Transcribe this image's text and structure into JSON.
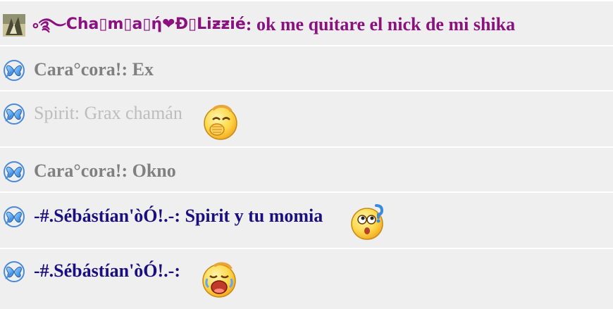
{
  "messages": [
    {
      "sender": "Cha▯m▯a▯ή❤Đ▯Liƶƶié",
      "sender_prefix": "༚࿐",
      "separator": ":",
      "text": " ok me quitare el nick de mi shika",
      "color": "#8b1180",
      "avatar": "photo-avatar-icon",
      "emoticon": null
    },
    {
      "sender": "Cara°cora!",
      "separator": ":",
      "text": " Ex",
      "color": "#808080",
      "avatar": "messenger-butterfly-icon",
      "emoticon": null
    },
    {
      "sender": "Spirit",
      "separator": ":",
      "text": " Grax chamán",
      "color": "#bdbdbd",
      "avatar": "messenger-butterfly-icon",
      "emoticon": "giggle-emoticon"
    },
    {
      "sender": "Cara°cora!",
      "separator": ":",
      "text": " Okno",
      "color": "#808080",
      "avatar": "messenger-butterfly-icon",
      "emoticon": null
    },
    {
      "sender": "-#.Sébástían'òÓ!.-",
      "separator": ":",
      "text": " Spirit y tu momia",
      "color": "#1a0f80",
      "avatar": "messenger-butterfly-icon",
      "emoticon": "confused-emoticon"
    },
    {
      "sender": "-#.Sébástían'òÓ!.-",
      "separator": ":",
      "text": "",
      "color": "#1a0f80",
      "avatar": "messenger-butterfly-icon",
      "emoticon": "crying-emoticon"
    }
  ]
}
